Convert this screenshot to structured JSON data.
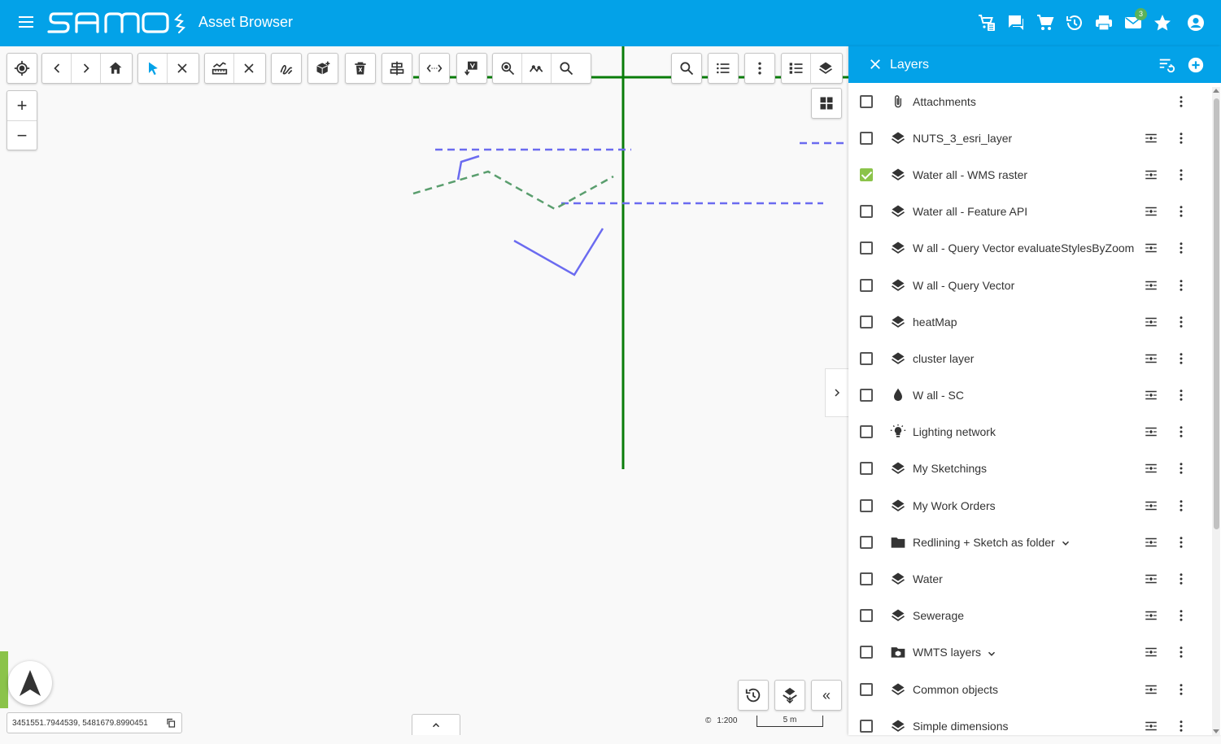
{
  "header": {
    "app_title": "Asset Browser",
    "brand_color": "#03a2e8",
    "mail_badge": "3",
    "icons": [
      "menu-icon",
      "logo",
      "shopping-list-icon",
      "chat-icon",
      "cart-icon",
      "history-icon",
      "print-icon",
      "mail-icon",
      "star-icon",
      "account-icon"
    ]
  },
  "map": {
    "toolbar_left": [
      "locate-icon",
      "back-icon",
      "forward-icon",
      "home-icon",
      "select-arrow-icon",
      "clear-selection-icon",
      "measure-icon",
      "clear-measure-icon",
      "sketch-icon",
      "add-feature-icon",
      "delete-icon",
      "align-icon",
      "distance-icon",
      "export-icon",
      "zoom-feature-icon",
      "profile-icon",
      "search-icon"
    ],
    "toolbar_right": [
      "search-icon",
      "list-icon",
      "more-vert-icon",
      "legend-icon",
      "layers-icon"
    ],
    "zoom_in": "+",
    "zoom_out": "−",
    "coordinates": "3451551.7944539, 5481679.8990451",
    "scale_label": "1:200",
    "scale_bar_label": "5 m",
    "colors": {
      "pipe_green": "#0a7d0a",
      "dashed_blue": "#6b6bf0",
      "dashed_green": "#5a9e6e"
    }
  },
  "panel": {
    "title": "Layers",
    "checked_color": "#8bc34a",
    "layers": [
      {
        "label": "Attachments",
        "icon": "attachment-icon",
        "checked": false,
        "has_opacity": false,
        "expandable": false
      },
      {
        "label": "NUTS_3_esri_layer",
        "icon": "layers-icon",
        "checked": false,
        "has_opacity": true,
        "expandable": false
      },
      {
        "label": "Water all - WMS raster",
        "icon": "layers-icon",
        "checked": true,
        "has_opacity": true,
        "expandable": false
      },
      {
        "label": "Water all - Feature API",
        "icon": "layers-icon",
        "checked": false,
        "has_opacity": true,
        "expandable": false
      },
      {
        "label": "W all - Query Vector evaluateStylesByZoom",
        "icon": "layers-icon",
        "checked": false,
        "has_opacity": true,
        "expandable": false
      },
      {
        "label": "W all - Query Vector",
        "icon": "layers-icon",
        "checked": false,
        "has_opacity": true,
        "expandable": false
      },
      {
        "label": "heatMap",
        "icon": "layers-icon",
        "checked": false,
        "has_opacity": true,
        "expandable": false
      },
      {
        "label": "cluster layer",
        "icon": "layers-icon",
        "checked": false,
        "has_opacity": true,
        "expandable": false
      },
      {
        "label": "W all - SC",
        "icon": "water-drop-icon",
        "checked": false,
        "has_opacity": true,
        "expandable": false
      },
      {
        "label": "Lighting network",
        "icon": "lightbulb-icon",
        "checked": false,
        "has_opacity": true,
        "expandable": false
      },
      {
        "label": "My Sketchings",
        "icon": "layers-icon",
        "checked": false,
        "has_opacity": true,
        "expandable": false
      },
      {
        "label": "My Work Orders",
        "icon": "layers-icon",
        "checked": false,
        "has_opacity": true,
        "expandable": false
      },
      {
        "label": "Redlining + Sketch as folder",
        "icon": "folder-icon",
        "checked": false,
        "has_opacity": true,
        "expandable": true
      },
      {
        "label": "Water",
        "icon": "layers-icon",
        "checked": false,
        "has_opacity": true,
        "expandable": false
      },
      {
        "label": "Sewerage",
        "icon": "layers-icon",
        "checked": false,
        "has_opacity": true,
        "expandable": false
      },
      {
        "label": "WMTS layers",
        "icon": "folder-special-icon",
        "checked": false,
        "has_opacity": true,
        "expandable": true
      },
      {
        "label": "Common objects",
        "icon": "layers-icon",
        "checked": false,
        "has_opacity": true,
        "expandable": false
      },
      {
        "label": "Simple dimensions",
        "icon": "layers-icon",
        "checked": false,
        "has_opacity": true,
        "expandable": false
      }
    ]
  }
}
